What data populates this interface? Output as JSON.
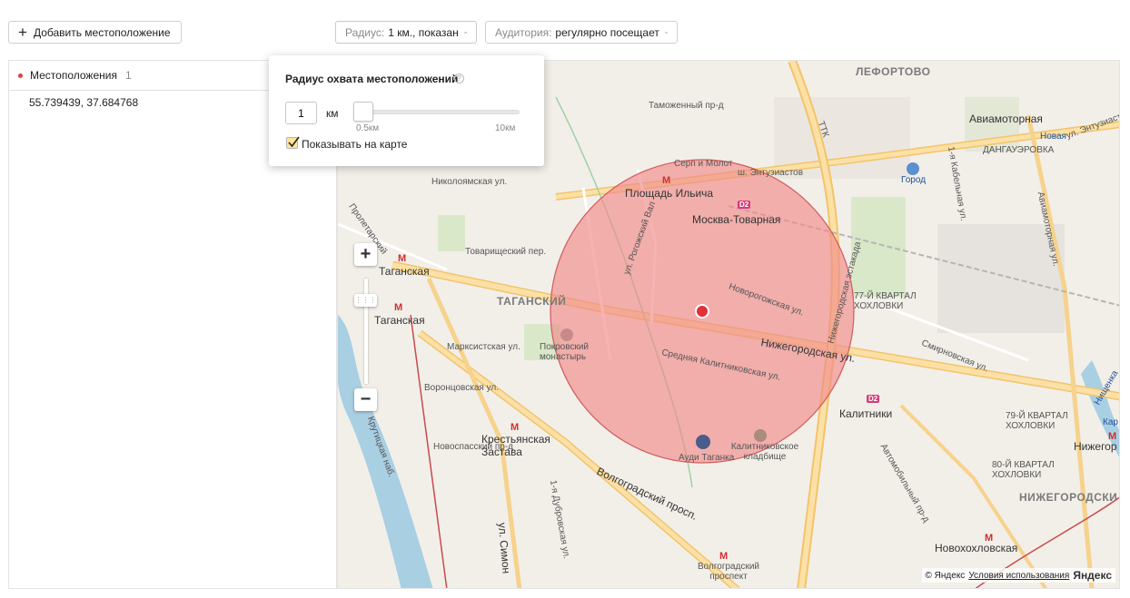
{
  "toolbar": {
    "add_location_label": "Добавить местоположение",
    "radius_prefix": "Радиус:",
    "radius_value": "1 км., показан",
    "audience_prefix": "Аудитория:",
    "audience_value": "регулярно посещает"
  },
  "locations": {
    "header": "Местоположения",
    "count": "1",
    "items": [
      "55.739439, 37.684768"
    ]
  },
  "radius_popover": {
    "title": "Радиус охвата местоположений",
    "help_icon": "?",
    "value": "1",
    "unit": "км",
    "slider_min": "0.5км",
    "slider_max": "10км",
    "slider_value_km": 1,
    "show_on_map_label": "Показывать на карте",
    "show_on_map_checked": true
  },
  "map": {
    "zoom_in": "+",
    "zoom_out": "−",
    "labels": {
      "lefortovo": "ЛЕФОРТОВО",
      "tagansky": "ТАГАНСКИЙ",
      "nizhegorodsky": "НИЖЕГОРОДСКИ",
      "serp_molot": "Серп и Молот",
      "ploshchad_ilicha": "Площадь Ильича",
      "moskva_tovarnaya": "Москва-Товарная",
      "sh_entuziastov": "ш. Энтузиастов",
      "nikoloyamskaya": "Николоямская ул.",
      "tamozhenny": "Таможенный пр-д",
      "taganskaya1": "Таганская",
      "taganskaya2": "Таганская",
      "tovarishchesky": "Товарищеский пер.",
      "marksistskaya": "Марксистская ул.",
      "vorontsovskaya": "Воронцовская ул.",
      "novospassky": "Новоспасский пр-д",
      "pokrovsky": "Покровский монастырь",
      "krestyanskaya": "Крестьянская Застава",
      "volgogradsky": "Волгоградский просп.",
      "volgogradsky_prospekt": "Волгоградский проспект",
      "rogozhsky": "ул. Рогожский Вал",
      "nizhegorodskaya_ul": "Нижегородская ул.",
      "srednyaya_kalit": "Средняя Калитниковская ул.",
      "novorogozhskaya": "Новорогожская ул.",
      "kalitnikovskoe": "Калитниковское кладбище",
      "audi": "Ауди Таганка",
      "kalitniki": "Калитники",
      "aviamotornaya": "Авиамоторная",
      "novaya": "Новая",
      "dangauerovka": "ДАНГАУЭРОВКА",
      "gorod": "Город",
      "kvartal77": "77-Й КВАРТАЛ ХОХЛОВКИ",
      "kvartal79": "79-Й КВАРТАЛ ХОХЛОВКИ",
      "kvartal80": "80-Й КВАРТАЛ ХОХЛОВКИ",
      "nizhegorodskaya_est": "Нижегородская эстакада",
      "ttk": "ТТК",
      "aviamotornaya_ul": "Авиамоторная ул.",
      "smirnovskaya": "Смирновская ул.",
      "avtomobilny": "Автомобильный пр-д",
      "novokhokhlovskaya": "Новохохловская",
      "nizhegorodnaya_m": "Нижегор",
      "kutuzovskaya": "Крутицкая наб.",
      "dubrovskaya": "1-я Дубровская ул.",
      "simonov": "ул. Симон",
      "kabelny": "1-я Кабельная ул.",
      "entuziastov_pr": "ул. Энтузиастов",
      "proletarsky": "Пролетарский",
      "nishchenka": "Нищенка",
      "kara": "Кар",
      "taganskaya_metro_top": "Таганская",
      "d2": "D2",
      "m": "М"
    },
    "copyright": "© Яндекс",
    "terms_link": "Условия использования",
    "logo": "Яндекс",
    "circle_color": "#f4a6a6",
    "marker_color": "#e0303a"
  }
}
